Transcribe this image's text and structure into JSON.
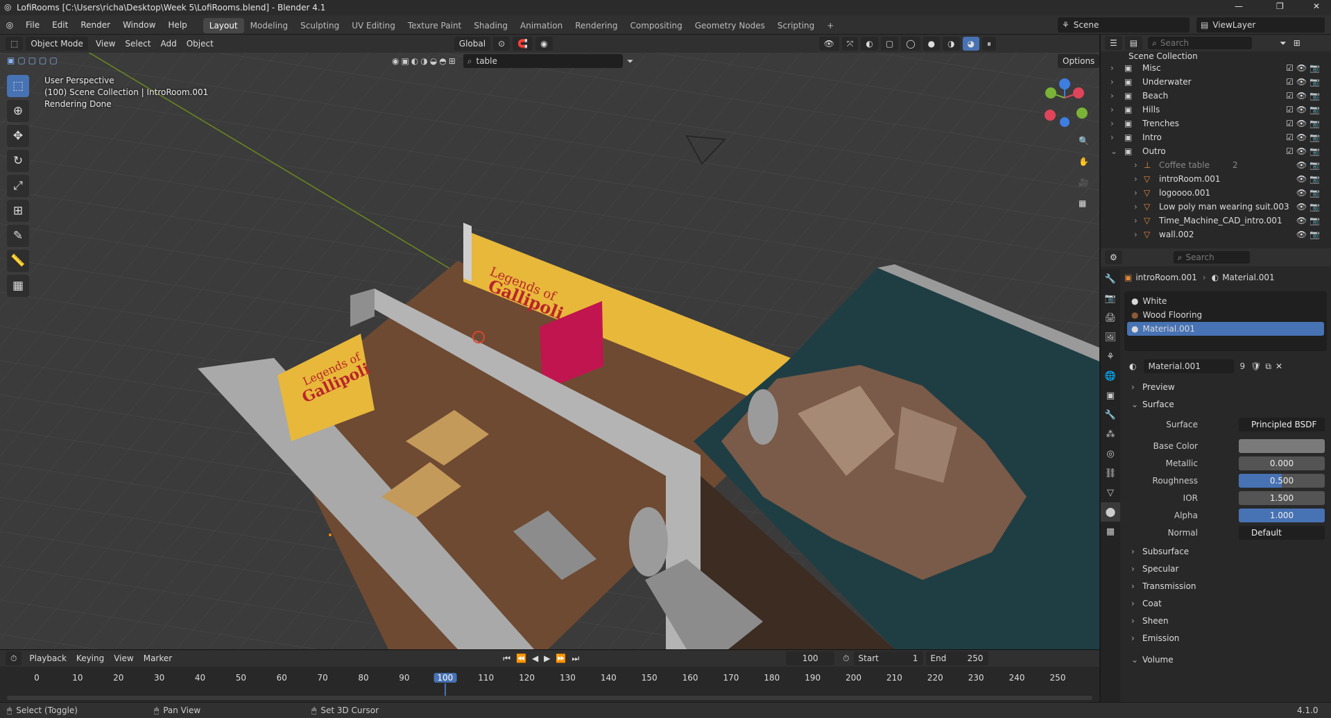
{
  "window": {
    "title": "LofiRooms [C:\\Users\\richa\\Desktop\\Week 5\\LofiRooms.blend] - Blender 4.1",
    "controls": [
      "minimize-icon",
      "maximize-icon",
      "close-icon"
    ]
  },
  "menus": [
    "File",
    "Edit",
    "Render",
    "Window",
    "Help"
  ],
  "workspaces": [
    "Layout",
    "Modeling",
    "Sculpting",
    "UV Editing",
    "Texture Paint",
    "Shading",
    "Animation",
    "Rendering",
    "Compositing",
    "Geometry Nodes",
    "Scripting"
  ],
  "active_workspace": "Layout",
  "scene": {
    "name": "Scene",
    "view_layer": "ViewLayer"
  },
  "viewport_header": {
    "mode": "Object Mode",
    "menus": [
      "View",
      "Select",
      "Add",
      "Object"
    ],
    "orientation": "Global",
    "search_value": "table",
    "options_label": "Options"
  },
  "viewport_overlay": {
    "line1": "User Perspective",
    "line2": "(100) Scene Collection | IntroRoom.001",
    "line3": "Rendering Done"
  },
  "scene_signs": {
    "sign_line1": "Legends of",
    "sign_line2": "Gallipoli"
  },
  "outliner": {
    "search_placeholder": "Search",
    "root": "Scene Collection",
    "collections": [
      {
        "name": "Misc",
        "open": false
      },
      {
        "name": "Underwater",
        "open": false
      },
      {
        "name": "Beach",
        "open": false
      },
      {
        "name": "Hills",
        "open": false
      },
      {
        "name": "Trenches",
        "open": false
      },
      {
        "name": "Intro",
        "open": false
      },
      {
        "name": "Outro",
        "open": true
      }
    ],
    "outro_children": [
      {
        "name": "Coffee table",
        "badge": "2",
        "dim": true
      },
      {
        "name": "introRoom.001"
      },
      {
        "name": "logoooo.001"
      },
      {
        "name": "Low poly man wearing suit.003"
      },
      {
        "name": "Time_Machine_CAD_intro.001"
      },
      {
        "name": "wall.002"
      }
    ]
  },
  "properties": {
    "search_placeholder": "Search",
    "breadcrumb_object": "introRoom.001",
    "breadcrumb_material": "Material.001",
    "material_slots": [
      "White",
      "Wood Flooring",
      "Material.001"
    ],
    "active_slot": "Material.001",
    "material_name": "Material.001",
    "user_count": "9",
    "sections": {
      "preview": "Preview",
      "surface": "Surface",
      "subsurface": "Subsurface",
      "specular": "Specular",
      "transmission": "Transmission",
      "coat": "Coat",
      "sheen": "Sheen",
      "emission": "Emission",
      "volume": "Volume"
    },
    "surface_fields": [
      {
        "label": "Surface",
        "value": "Principled BSDF"
      },
      {
        "label": "Base Color",
        "value": ""
      },
      {
        "label": "Metallic",
        "value": "0.000"
      },
      {
        "label": "Roughness",
        "value": "0.500"
      },
      {
        "label": "IOR",
        "value": "1.500"
      },
      {
        "label": "Alpha",
        "value": "1.000"
      },
      {
        "label": "Normal",
        "value": "Default"
      }
    ]
  },
  "timeline": {
    "menus": [
      "Playback",
      "Keying",
      "View",
      "Marker"
    ],
    "current_frame": "100",
    "start_label": "Start",
    "start": "1",
    "end_label": "End",
    "end": "250",
    "ticks": [
      "0",
      "10",
      "20",
      "30",
      "40",
      "50",
      "60",
      "70",
      "80",
      "90",
      "100",
      "110",
      "120",
      "130",
      "140",
      "150",
      "160",
      "170",
      "180",
      "190",
      "200",
      "210",
      "220",
      "230",
      "240",
      "250"
    ]
  },
  "statusbar": {
    "select": "Select (Toggle)",
    "pan": "Pan View",
    "cursor": "Set 3D Cursor",
    "version": "4.1.0"
  },
  "colors": {
    "accent": "#4772b3",
    "sign_yellow": "#e8b83a",
    "sign_red": "#c0154e",
    "floor_wood": "#6e4a33",
    "wall_grey": "#a9a9a9"
  }
}
